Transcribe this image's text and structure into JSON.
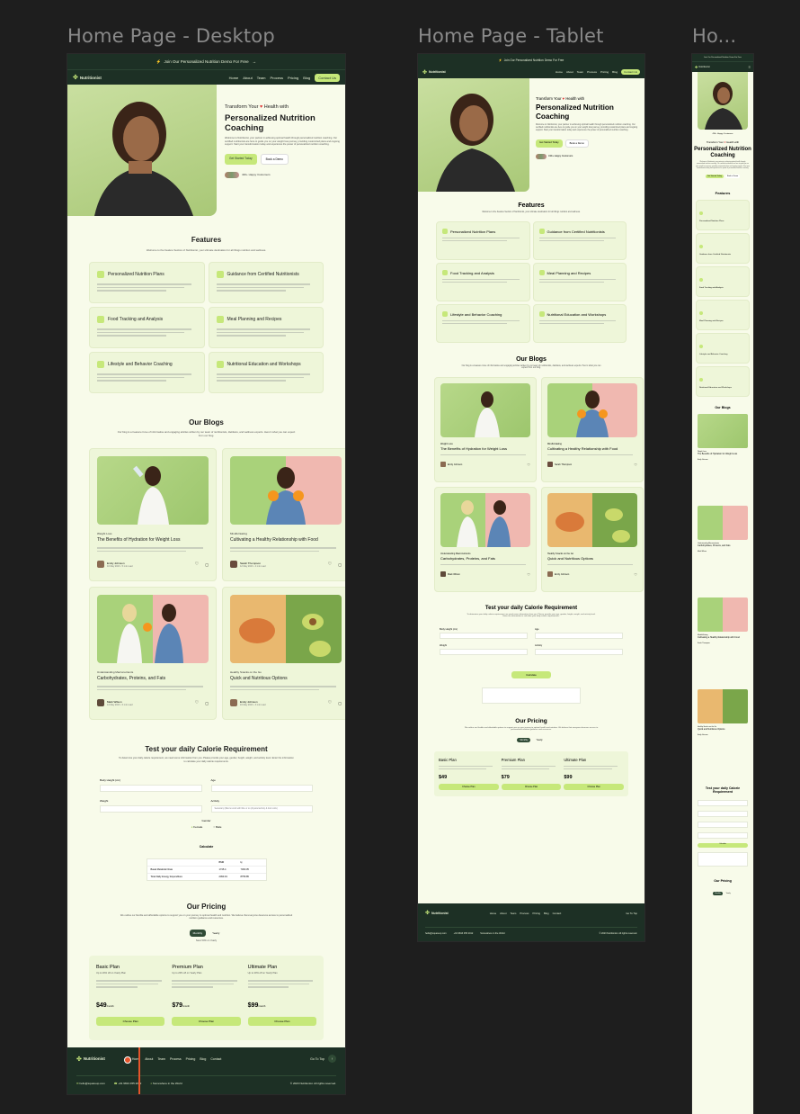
{
  "frames": {
    "desktop_label": "Home Page - Desktop",
    "tablet_label": "Home Page - Tablet",
    "mobile_label": "Ho..."
  },
  "topbar": {
    "text": "Join Our Personalized Nutrition Demo For Free"
  },
  "nav": {
    "logo": "Nutritionist",
    "items": [
      "Home",
      "About",
      "Team",
      "Process",
      "Pricing",
      "Blog"
    ],
    "cta": "Contact Us"
  },
  "hero": {
    "eyebrow": "Transform Your",
    "eyebrow_after": "Health with",
    "title": "Personalized Nutrition Coaching",
    "body": "Welcome to Nutritionist, your partner in achieving optimal health through personalized nutrition coaching. Our certified nutritionists are here to guide you on your weight loss journey, providing customized plans and ongoing support. Start your transformation today and experience the power of personalized nutrition coaching.",
    "primary_btn": "Get Started Today",
    "secondary_btn": "Book a Demo",
    "customers": "430+ Happy Customers"
  },
  "features": {
    "title": "Features",
    "subtitle": "Welcome to the Feature Section of Nutritionist, your ultimate destination for all things nutrition and wellness.",
    "items": [
      {
        "title": "Personalized Nutrition Plans"
      },
      {
        "title": "Guidance from Certified Nutritionists"
      },
      {
        "title": "Food Tracking and Analysis"
      },
      {
        "title": "Meal Planning and Recipes"
      },
      {
        "title": "Lifestyle and Behavior Coaching"
      },
      {
        "title": "Nutritional Education and Workshops"
      }
    ]
  },
  "blogs": {
    "title": "Our Blogs",
    "subtitle": "Our blog is a treasure trove of informative and engaging articles written by our team of nutritionists, dietitians, and wellness experts. Here's what you can expect from our blog.",
    "items": [
      {
        "category": "Weight Loss",
        "title": "The Benefits of Hydration for Weight Loss",
        "author": "Emily Johnson",
        "date": "10 May 2023 - 5 min read",
        "img": "water"
      },
      {
        "category": "Mindful Eating",
        "title": "Cultivating a Healthy Relationship with Food",
        "author": "Sarah Thompson",
        "date": "12 May 2023 - 4 min read",
        "img": "orange-green"
      },
      {
        "category": "Understanding Macronutrients",
        "title": "Carbohydrates, Proteins, and Fats",
        "author": "Mark Wilson",
        "date": "14 May 2023 - 6 min read",
        "img": "duo"
      },
      {
        "category": "Healthy Snacks on the Go",
        "title": "Quick and Nutritious Options",
        "author": "Emily Johnson",
        "date": "16 May 2023 - 3 min read",
        "img": "food"
      }
    ]
  },
  "calorie": {
    "title": "Test your daily Calorie Requirement",
    "subtitle": "To determine your daily calorie requirement, we need some information from you. Please provide your age, gender, height, weight, and activity level. Enter the information to calculate your daily calorie requirements.",
    "labels": {
      "height": "Body Height (cm)",
      "age": "Age",
      "weight": "Weight",
      "activity": "Activity",
      "gender": "Gender",
      "male": "Female",
      "female": "Male"
    },
    "activity_placeholder": "Sedentary (little/no work with little or no physical activity & food units)",
    "button": "Calculate",
    "table_head": [
      "BMR",
      "kj"
    ],
    "table_rows": [
      [
        "Basal Metabolic Rate",
        "1745.4",
        "7303.35"
      ],
      [
        "Total Daily Energy Expenditure",
        "2093.19",
        "8756.85"
      ]
    ]
  },
  "pricing": {
    "title": "Our Pricing",
    "subtitle": "We outline our flexible and affordable options to support you on your journey to optimal health and nutrition. We believe that everyone deserves access to personalized nutrition guidance and resources.",
    "toggle": [
      "Monthly",
      "Yearly"
    ],
    "save_note": "Save 50% on Yearly",
    "plans": [
      {
        "name": "Basic Plan",
        "desc": "Up to 20% off on Yearly Plan",
        "price": "$49",
        "per": "/month",
        "cta": "Choose Plan"
      },
      {
        "name": "Premium Plan",
        "desc": "Up to 20% off on Yearly Plan",
        "price": "$79",
        "per": "/month",
        "cta": "Choose Plan"
      },
      {
        "name": "Ultimate Plan",
        "desc": "Up to 20% off on Yearly Plan",
        "price": "$99",
        "per": "/month",
        "cta": "Choose Plan"
      }
    ]
  },
  "footer": {
    "logo": "Nutritionist",
    "links": [
      "Home",
      "About",
      "Team",
      "Process",
      "Pricing",
      "Blog",
      "Contact"
    ],
    "top": "Go To Top",
    "email": "hello@squareup.com",
    "phone": "+91 9813 455 2012",
    "location": "Somewhere in the World",
    "copyright": "© 2023 Nutritionist. All rights reserved."
  },
  "colors": {
    "accent": "#c6e87a",
    "dark": "#1d3025",
    "bg": "#f8fbea",
    "canvas": "#1e1e1e"
  }
}
